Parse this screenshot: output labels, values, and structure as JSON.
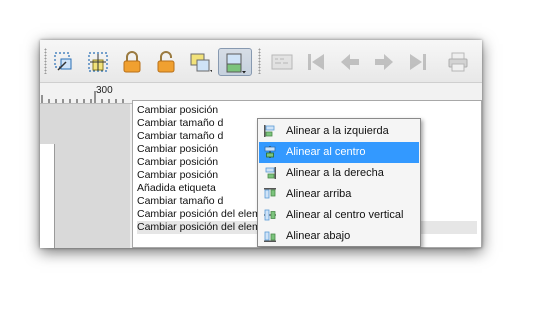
{
  "toolbar": {
    "buttons": [
      {
        "icon": "select-move-item-icon"
      },
      {
        "icon": "move-item-content-icon"
      },
      {
        "icon": "lock-icon"
      },
      {
        "icon": "unlock-icon"
      },
      {
        "icon": "group-items-icon"
      },
      {
        "icon": "align-items-icon"
      },
      {
        "icon": "atlas-preview-icon"
      },
      {
        "icon": "first-feature-icon"
      },
      {
        "icon": "previous-feature-icon"
      },
      {
        "icon": "next-feature-icon"
      },
      {
        "icon": "last-feature-icon"
      },
      {
        "icon": "print-atlas-icon"
      }
    ]
  },
  "ruler": {
    "label": "300"
  },
  "history": {
    "items": [
      "Cambiar posición",
      "Cambiar tamaño d",
      "Cambiar tamaño d",
      "Cambiar posición",
      "Cambiar posición",
      "Cambiar posición",
      "Añadida etiqueta",
      "Cambiar tamaño d",
      "Cambiar posición del elemento",
      "Cambiar posición del elemento"
    ],
    "selected_index": 9
  },
  "align_menu": {
    "items": [
      {
        "label": "Alinear a la izquierda",
        "icon": "align-left-icon"
      },
      {
        "label": "Alinear al centro",
        "icon": "align-center-icon"
      },
      {
        "label": "Alinear a la derecha",
        "icon": "align-right-icon"
      },
      {
        "label": "Alinear arriba",
        "icon": "align-top-icon"
      },
      {
        "label": "Alinear al centro vertical",
        "icon": "align-vcenter-icon"
      },
      {
        "label": "Alinear abajo",
        "icon": "align-bottom-icon"
      }
    ],
    "active_index": 1
  },
  "colors": {
    "menu_highlight": "#3399ff",
    "lock_orange": "#f0a030",
    "align_green": "#7cc47c",
    "align_blue": "#5a9bd5"
  }
}
